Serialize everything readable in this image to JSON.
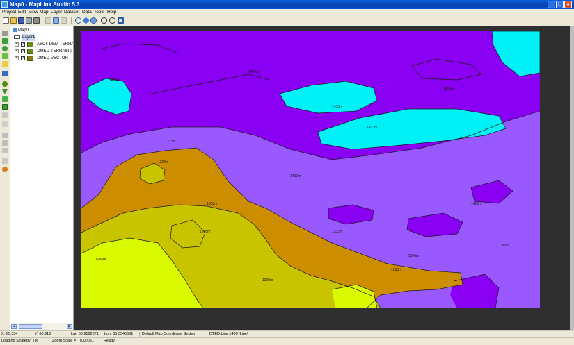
{
  "window": {
    "title": "Map0 - MapLink Studio 5.3"
  },
  "menu": [
    "Project",
    "Edit",
    "View",
    "Map",
    "Layer",
    "Dataset",
    "Data",
    "Tools",
    "Help"
  ],
  "tree": {
    "root": "Map0",
    "layer": "Layer1",
    "items": [
      "[ ASCII-DEM-TERRAIN ]",
      "[ DMED-TERRAIN ]",
      "[ DMED-VECTOR ]"
    ]
  },
  "map": {
    "colors": {
      "violet": "#8a00f2",
      "lavender": "#9a59ff",
      "cyan": "#00f2f7",
      "orange": "#cc8e00",
      "olive": "#c9c400",
      "yellow": "#d9fa00",
      "frame": "#2f2f2f"
    },
    "labels": [
      "1400m",
      "1433m",
      "1333m",
      "1366m",
      "1300m",
      "1266m",
      "1233m"
    ]
  },
  "status": {
    "x": "X: 65.354",
    "y": "Y: 60.916",
    "lat": "Lat: 60.9162671",
    "lon": "Lon: 65.3540561",
    "coord_system": "Default Map Coordinate System",
    "layer_info": "DTED.Line.1400 [Line]",
    "loading": "Loading Strategy: Tile",
    "zoom": "Zoom Scale =",
    "zoom_value": "0.00061",
    "ready": "Ready"
  }
}
